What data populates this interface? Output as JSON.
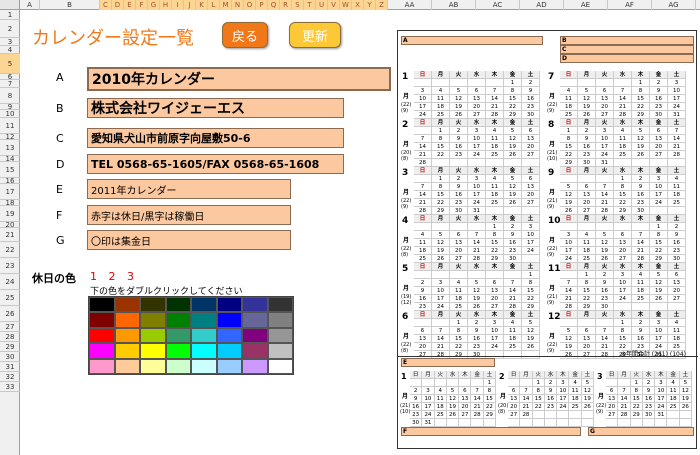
{
  "columns": [
    "A",
    "B",
    "C",
    "D",
    "E",
    "F",
    "G",
    "H",
    "I",
    "J",
    "K",
    "L",
    "M",
    "N",
    "O",
    "P",
    "Q",
    "R",
    "S",
    "T",
    "U",
    "V",
    "W",
    "X",
    "Y",
    "Z",
    "AA",
    "AB",
    "AC",
    "AD",
    "AE",
    "AF",
    "AG"
  ],
  "rows": [
    "1",
    "2",
    "3",
    "4",
    "5",
    "6",
    "7",
    "8",
    "9",
    "10",
    "11",
    "12",
    "13",
    "14",
    "15",
    "16",
    "17",
    "18",
    "19",
    "20",
    "21",
    "22",
    "23",
    "24",
    "25",
    "26",
    "27",
    "28",
    "29",
    "30",
    "31",
    "32",
    "33"
  ],
  "page_title": "カレンダー設定一覧",
  "buttons": {
    "back": "戻る",
    "update": "更新"
  },
  "fields": [
    {
      "label": "A",
      "value": "2010年カレンダー"
    },
    {
      "label": "B",
      "value": "株式会社ワイジェーエス"
    },
    {
      "label": "C",
      "value": "愛知県犬山市前原字向屋敷50-6"
    },
    {
      "label": "D",
      "value": "TEL 0568-65-1605/FAX 0568-65-1608"
    },
    {
      "label": "E",
      "value": "2011年カレンダー"
    },
    {
      "label": "F",
      "value": "赤字は休日/黒字は稼働日"
    },
    {
      "label": "G",
      "value": "〇印は集金日"
    }
  ],
  "holiday": {
    "label": "休日の色",
    "numbers": "1 2 3",
    "hint": "下の色をダブルクリックしてください"
  },
  "palette": [
    "#000000",
    "#993300",
    "#333300",
    "#003300",
    "#003366",
    "#000080",
    "#333399",
    "#333333",
    "#800000",
    "#ff6600",
    "#808000",
    "#008000",
    "#008080",
    "#0000ff",
    "#666699",
    "#808080",
    "#ff0000",
    "#ff9900",
    "#99cc00",
    "#339966",
    "#33cccc",
    "#3366ff",
    "#800080",
    "#969696",
    "#ff00ff",
    "#ffcc00",
    "#ffff00",
    "#00ff00",
    "#00ffff",
    "#00ccff",
    "#993366",
    "#c0c0c0",
    "#ff99cc",
    "#ffcc99",
    "#ffff99",
    "#ccffcc",
    "#ccffff",
    "#99ccff",
    "#cc99ff",
    "#ffffff"
  ],
  "preview": {
    "label_a": "A",
    "label_b": "B",
    "label_c": "C",
    "label_d": "D",
    "label_e": "E",
    "label_f": "F",
    "label_g": "G",
    "weekdays": [
      "日",
      "月",
      "火",
      "水",
      "木",
      "金",
      "土"
    ],
    "getsu": "月",
    "months": [
      {
        "n": "1",
        "first": 5,
        "days": 31,
        "notes": [
          "(22)",
          "(9)"
        ]
      },
      {
        "n": "7",
        "first": 4,
        "days": 31,
        "notes": [
          "(22)",
          "(9)"
        ]
      },
      {
        "n": "2",
        "first": 1,
        "days": 28,
        "notes": [
          "(20)",
          "(8)"
        ]
      },
      {
        "n": "8",
        "first": 0,
        "days": 31,
        "notes": [
          "(21)",
          "(10)"
        ]
      },
      {
        "n": "3",
        "first": 1,
        "days": 31,
        "notes": [
          "(22)",
          "(9)"
        ]
      },
      {
        "n": "9",
        "first": 3,
        "days": 30,
        "notes": [
          "(21)",
          "(9)"
        ]
      },
      {
        "n": "4",
        "first": 4,
        "days": 30,
        "notes": [
          "(22)",
          "(8)"
        ]
      },
      {
        "n": "10",
        "first": 5,
        "days": 31,
        "notes": [
          "(22)",
          "(9)"
        ]
      },
      {
        "n": "5",
        "first": 6,
        "days": 31,
        "notes": [
          "(19)",
          "(12)"
        ]
      },
      {
        "n": "11",
        "first": 1,
        "days": 30,
        "notes": [
          "(21)",
          "(9)"
        ]
      },
      {
        "n": "6",
        "first": 2,
        "days": 30,
        "notes": [
          "(22)",
          "(8)"
        ]
      },
      {
        "n": "12",
        "first": 3,
        "days": 31,
        "notes": [
          "(22)",
          "(9)"
        ]
      }
    ],
    "footer": "※年間合計 (261) (104)",
    "next_year": [
      {
        "n": "1",
        "first": 6,
        "days": 31,
        "notes": [
          "(21)",
          "(10)"
        ]
      },
      {
        "n": "2",
        "first": 2,
        "days": 28,
        "notes": [
          "(20)",
          "(8)"
        ]
      },
      {
        "n": "3",
        "first": 2,
        "days": 31,
        "notes": [
          "(22)",
          "(9)"
        ]
      }
    ]
  }
}
